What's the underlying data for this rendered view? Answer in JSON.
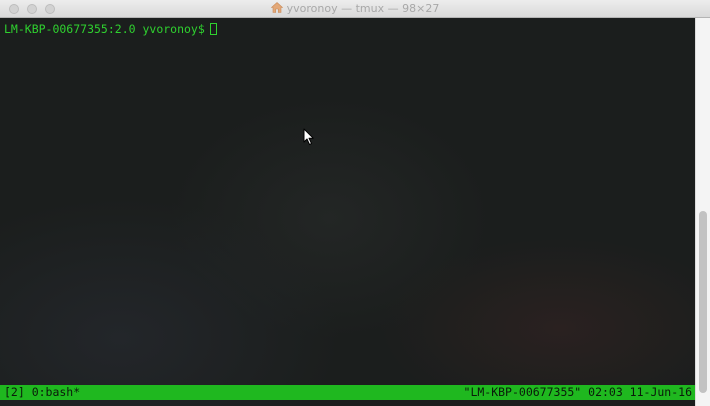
{
  "window": {
    "title": "yvoronoy — tmux — 98×27",
    "title_icon": "home-icon"
  },
  "terminal": {
    "prompt": "LM-KBP-00677355:2.0 yvoronoy$",
    "text_color": "#2fd12f"
  },
  "statusbar": {
    "left": "[2] 0:bash*",
    "right": "\"LM-KBP-00677355\" 02:03 11-Jun-16",
    "background": "#1fb81f"
  }
}
